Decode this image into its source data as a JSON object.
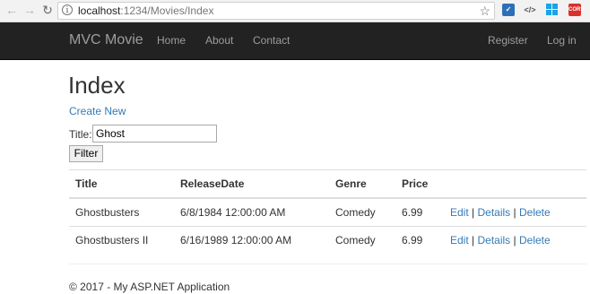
{
  "browser": {
    "url_host": "localhost",
    "url_path": ":1234/Movies/Index",
    "extensions": [
      "shield-icon",
      "code-icon",
      "windows-icon",
      "cors-icon"
    ],
    "cors_label": "CORS"
  },
  "navbar": {
    "brand": "MVC Movie",
    "links": [
      "Home",
      "About",
      "Contact"
    ],
    "right_links": [
      "Register",
      "Log in"
    ]
  },
  "page": {
    "title": "Index",
    "create_link": "Create New"
  },
  "filter": {
    "label": "Title:",
    "value": "Ghost",
    "button": "Filter"
  },
  "table": {
    "headers": [
      "Title",
      "ReleaseDate",
      "Genre",
      "Price"
    ],
    "rows": [
      {
        "title": "Ghostbusters",
        "release": "6/8/1984 12:00:00 AM",
        "genre": "Comedy",
        "price": "6.99"
      },
      {
        "title": "Ghostbusters II",
        "release": "6/16/1989 12:00:00 AM",
        "genre": "Comedy",
        "price": "6.99"
      }
    ],
    "actions": {
      "edit": "Edit",
      "details": "Details",
      "delete": "Delete",
      "separator": "|"
    }
  },
  "footer": "© 2017 - My ASP.NET Application",
  "colors": {
    "link": "#337ab7",
    "navbar": "#222222",
    "nav_text": "#9d9d9d"
  }
}
